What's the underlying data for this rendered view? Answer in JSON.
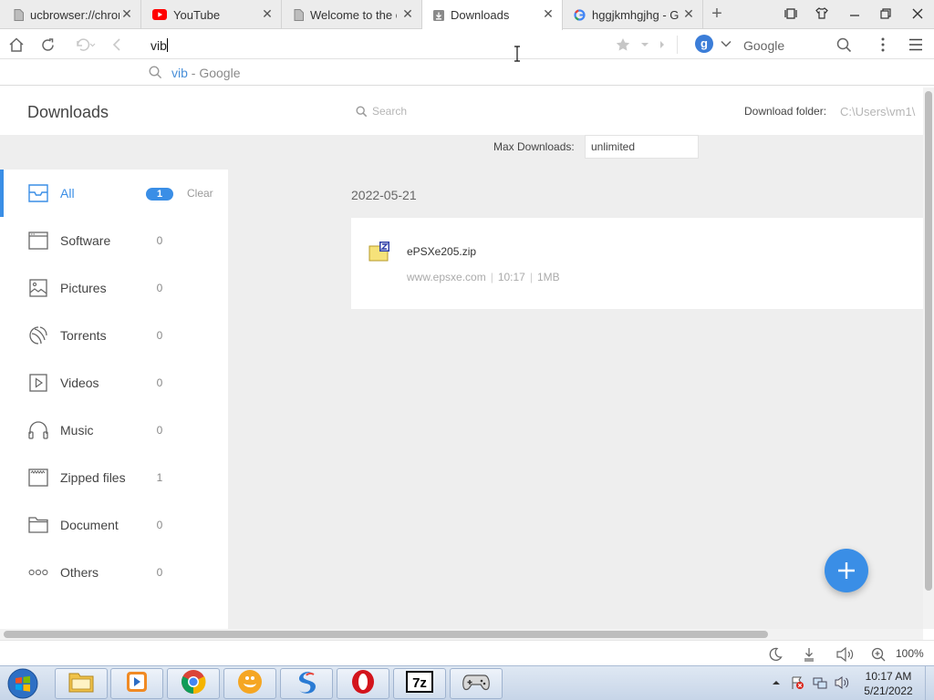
{
  "tabs": [
    {
      "title": "ucbrowser://chrome",
      "icon": "page-icon",
      "active": false
    },
    {
      "title": "YouTube",
      "icon": "youtube-icon",
      "active": false
    },
    {
      "title": "Welcome to the official",
      "icon": "page-icon",
      "active": false
    },
    {
      "title": "Downloads",
      "icon": "download-icon",
      "active": true
    },
    {
      "title": "hggjkmhgjhg - Google",
      "icon": "google-icon",
      "active": false
    }
  ],
  "address_bar": {
    "value": "vib",
    "search_engine_letter": "g",
    "search_engine_label": "Google"
  },
  "suggestion": {
    "term": "vib",
    "rest": " - Google"
  },
  "downloads": {
    "title": "Downloads",
    "search_placeholder": "Search",
    "folder_label": "Download folder:",
    "folder_value": "C:\\Users\\vm1\\",
    "max_label": "Max Downloads:",
    "max_value": "unlimited",
    "clear_label": "Clear",
    "categories": [
      {
        "label": "All",
        "count": "1",
        "icon": "inbox-icon",
        "active": true
      },
      {
        "label": "Software",
        "count": "0",
        "icon": "window-icon",
        "active": false
      },
      {
        "label": "Pictures",
        "count": "0",
        "icon": "image-icon",
        "active": false
      },
      {
        "label": "Torrents",
        "count": "0",
        "icon": "torrent-icon",
        "active": false
      },
      {
        "label": "Videos",
        "count": "0",
        "icon": "video-icon",
        "active": false
      },
      {
        "label": "Music",
        "count": "0",
        "icon": "headphones-icon",
        "active": false
      },
      {
        "label": "Zipped files",
        "count": "1",
        "icon": "zip-icon",
        "active": false
      },
      {
        "label": "Document",
        "count": "0",
        "icon": "folder-icon",
        "active": false
      },
      {
        "label": "Others",
        "count": "0",
        "icon": "more-icon",
        "active": false
      }
    ],
    "date_group": "2022-05-21",
    "file": {
      "name": "ePSXe205.zip",
      "source": "www.epsxe.com",
      "time": "10:17",
      "size": "1MB"
    }
  },
  "status_bar": {
    "zoom": "100%"
  },
  "taskbar": {
    "apps": [
      "explorer-icon",
      "media-player-icon",
      "chrome-icon",
      "uc-browser-icon",
      "browser-icon",
      "opera-icon",
      "7zip-icon",
      "gamepad-icon"
    ],
    "time": "10:17 AM",
    "date": "5/21/2022"
  },
  "colors": {
    "accent": "#3a8ee6",
    "page_bg": "#eeeeee",
    "youtube_red": "#ff0000"
  }
}
